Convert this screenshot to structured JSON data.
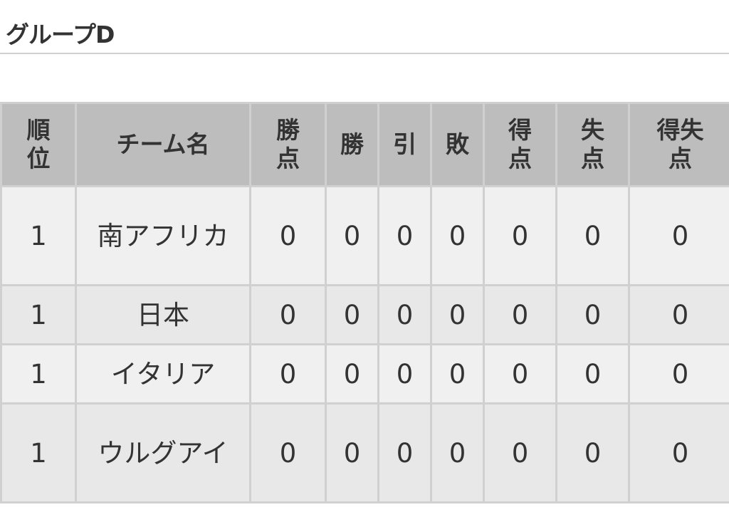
{
  "group": {
    "title": "グループD"
  },
  "table": {
    "headers": {
      "rank": "順位",
      "team": "チーム名",
      "points": "勝点",
      "wins": "勝",
      "draws": "引",
      "losses": "敗",
      "goals_for": "得点",
      "goals_against": "失点",
      "goal_difference": "得失点"
    },
    "rows": [
      {
        "rank": "1",
        "team": "南アフリカ",
        "points": "0",
        "wins": "0",
        "draws": "0",
        "losses": "0",
        "goals_for": "0",
        "goals_against": "0",
        "goal_difference": "0"
      },
      {
        "rank": "1",
        "team": "日本",
        "points": "0",
        "wins": "0",
        "draws": "0",
        "losses": "0",
        "goals_for": "0",
        "goals_against": "0",
        "goal_difference": "0"
      },
      {
        "rank": "1",
        "team": "イタリア",
        "points": "0",
        "wins": "0",
        "draws": "0",
        "losses": "0",
        "goals_for": "0",
        "goals_against": "0",
        "goal_difference": "0"
      },
      {
        "rank": "1",
        "team": "ウルグアイ",
        "points": "0",
        "wins": "0",
        "draws": "0",
        "losses": "0",
        "goals_for": "0",
        "goals_against": "0",
        "goal_difference": "0"
      }
    ]
  }
}
